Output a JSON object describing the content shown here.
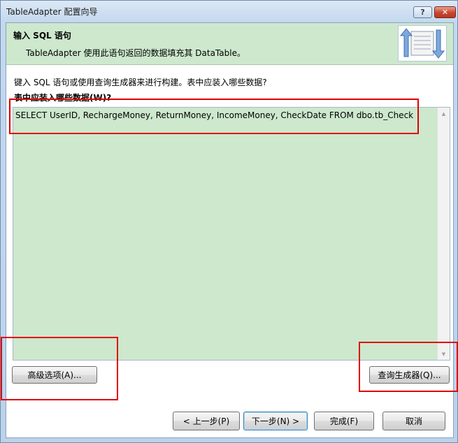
{
  "window": {
    "title": "TableAdapter 配置向导",
    "help_glyph": "?",
    "close_glyph": "✕"
  },
  "header": {
    "title": "输入 SQL 语句",
    "subtitle": "TableAdapter 使用此语句返回的数据填充其 DataTable。"
  },
  "body": {
    "intro": "键入 SQL 语句或使用查询生成器来进行构建。表中应装入哪些数据?",
    "question": "表中应装入哪些数据(W)?",
    "sql_text": "SELECT UserID, RechargeMoney, ReturnMoney, IncomeMoney, CheckDate FROM dbo.tb_Check"
  },
  "buttons": {
    "advanced": "高级选项(A)...",
    "query_builder": "查询生成器(Q)...",
    "previous": "< 上一步(P)",
    "next": "下一步(N) >",
    "finish": "完成(F)",
    "cancel": "取消"
  },
  "colors": {
    "highlight": "#e00000",
    "header_band": "#cde8cd",
    "sql_background": "#cde8cd"
  },
  "icons": {
    "help": "help-icon",
    "close": "close-icon",
    "wizard": "table-adapter-wizard-icon"
  }
}
